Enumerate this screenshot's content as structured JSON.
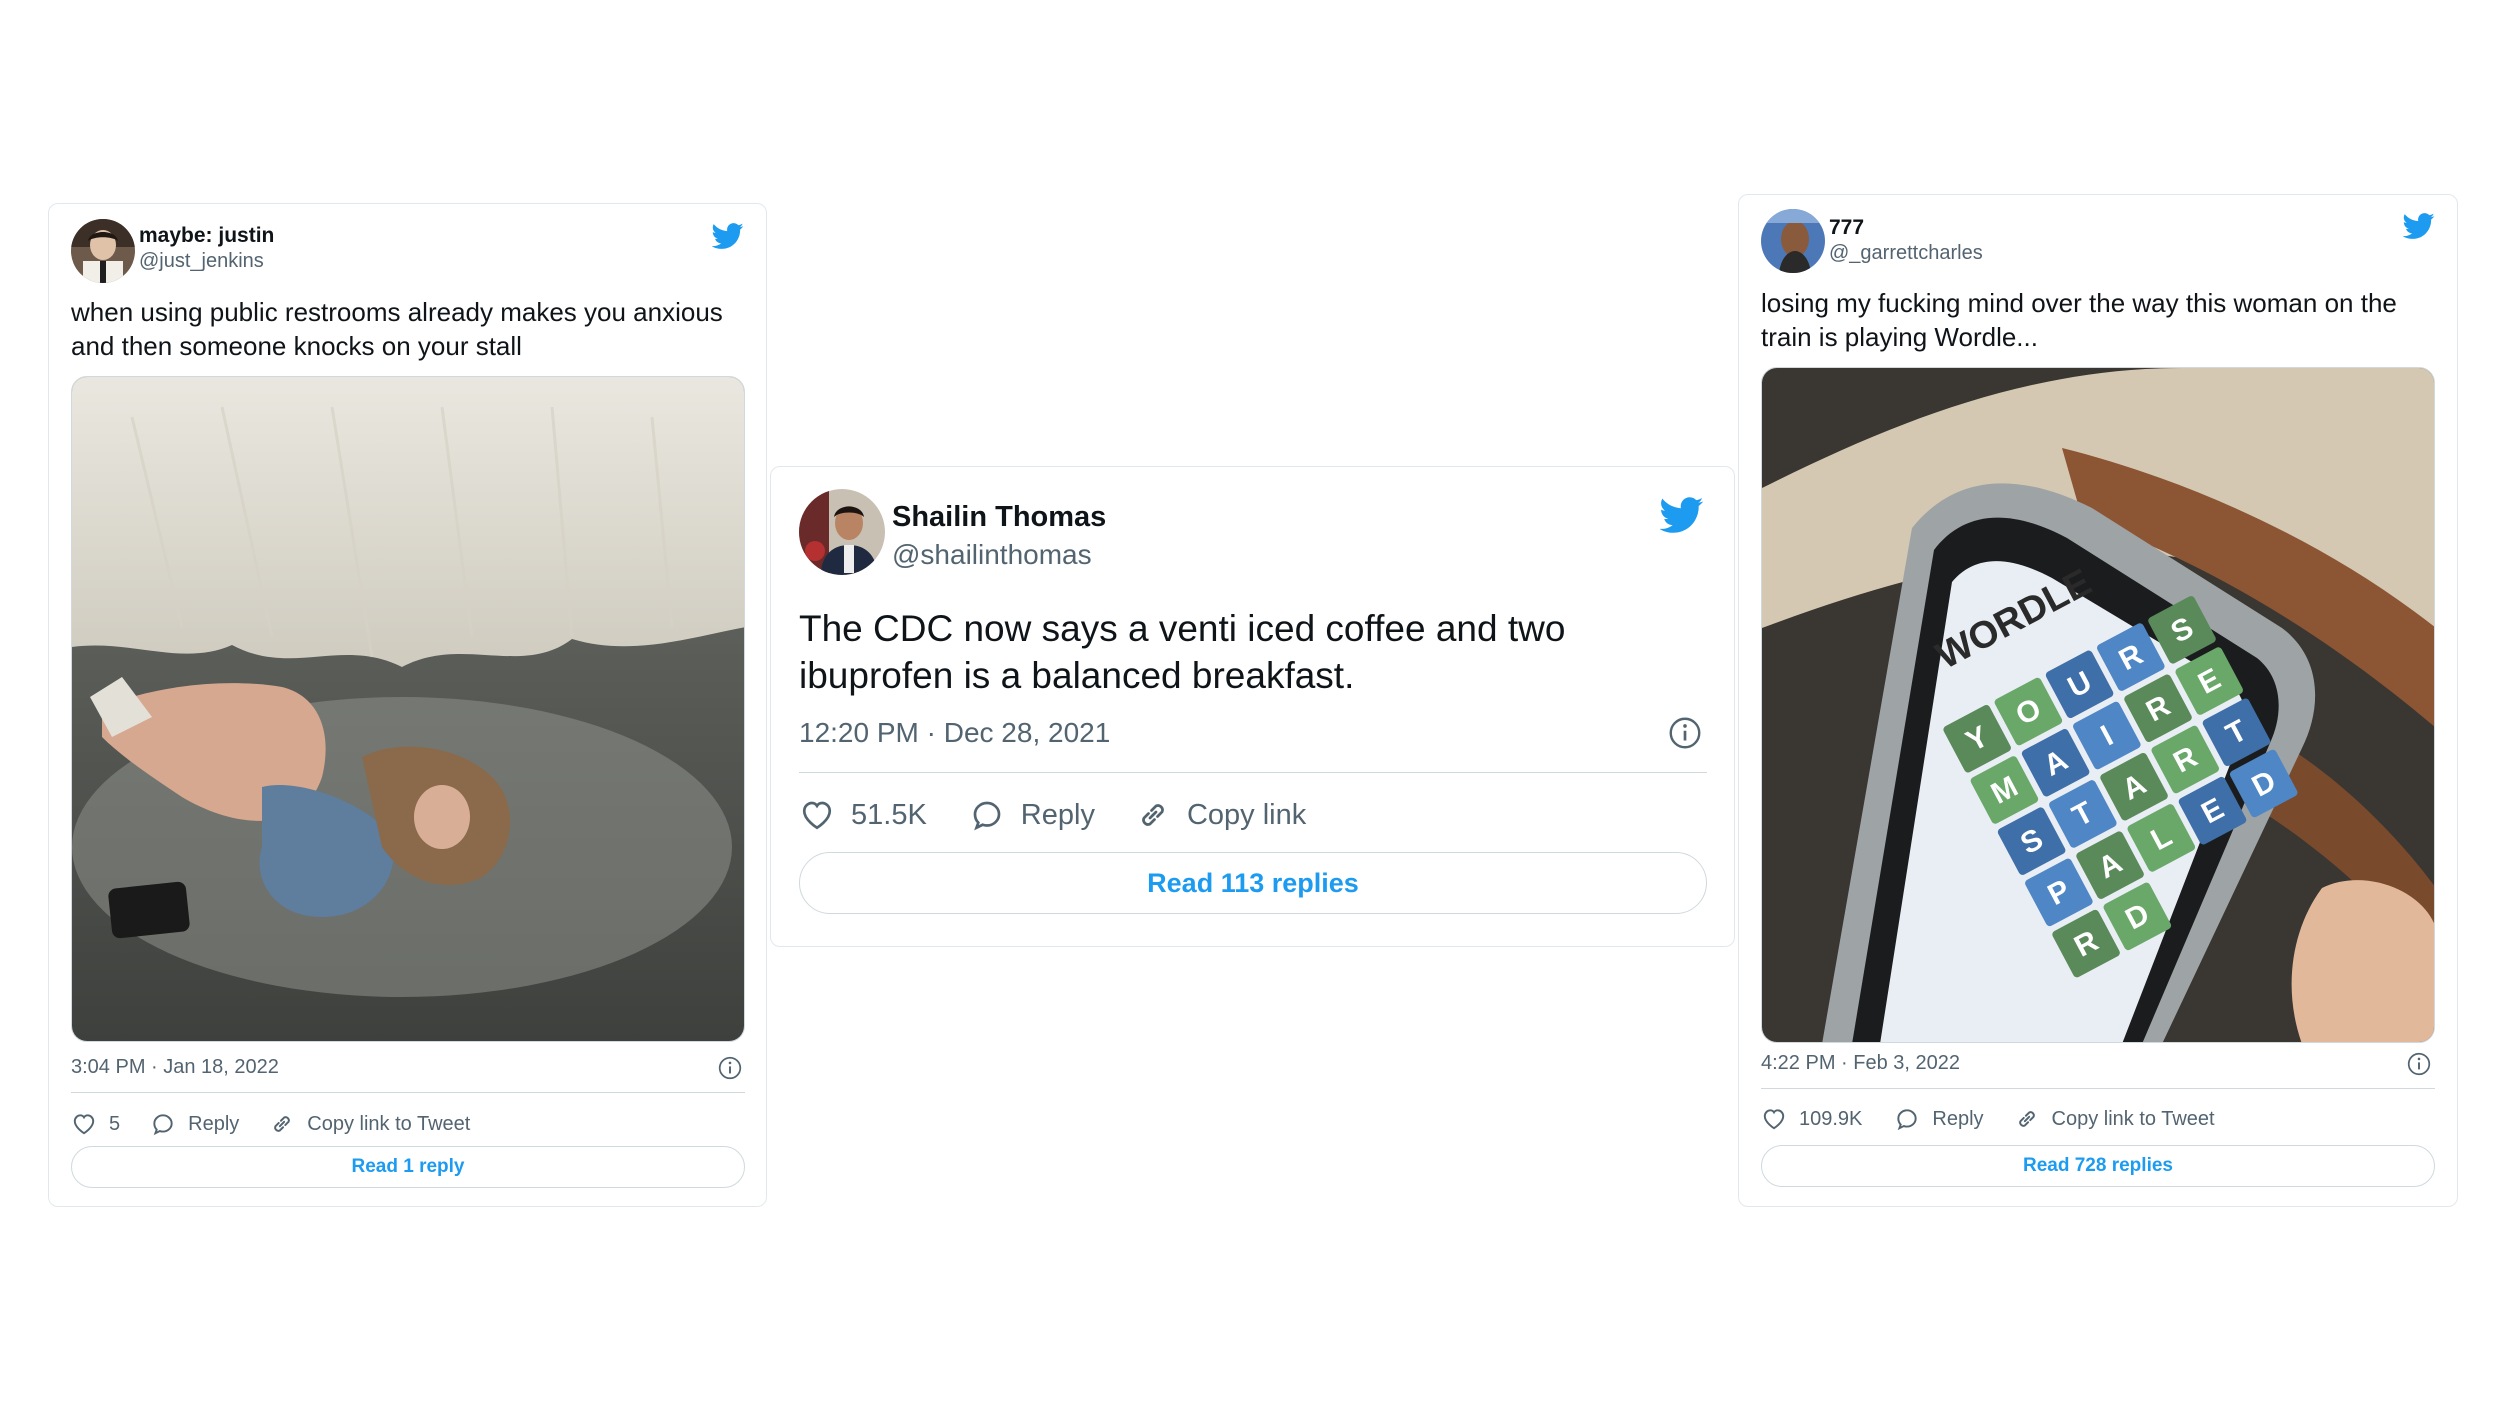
{
  "colors": {
    "twitter_blue": "#1d9bf0",
    "secondary_text": "#536471",
    "border": "#cfd9de"
  },
  "tweets": [
    {
      "name": "maybe: justin",
      "handle": "@just_jenkins",
      "text": "when using public restrooms already makes you anxious and then someone knocks on your stall",
      "timestamp": "3:04 PM · Jan 18, 2022",
      "likes": "5",
      "reply_label": "Reply",
      "copy_label": "Copy link to Tweet",
      "read_replies": "Read 1 reply",
      "icons": [
        "twitter-bird-icon",
        "info-icon",
        "heart-icon",
        "reply-bubble-icon",
        "link-icon"
      ]
    },
    {
      "name": "Shailin Thomas",
      "handle": "@shailinthomas",
      "text": "The CDC now says a venti iced coffee and two ibuprofen is a balanced breakfast.",
      "timestamp": "12:20 PM · Dec 28, 2021",
      "likes": "51.5K",
      "reply_label": "Reply",
      "copy_label": "Copy link",
      "read_replies": "Read 113 replies",
      "icons": [
        "twitter-bird-icon",
        "info-icon",
        "heart-icon",
        "reply-bubble-icon",
        "link-icon"
      ]
    },
    {
      "name": "777",
      "handle": "@_garrettcharles",
      "text": "losing my fucking mind over the way this woman on the train is playing Wordle...",
      "timestamp": "4:22 PM · Feb 3, 2022",
      "likes": "109.9K",
      "reply_label": "Reply",
      "copy_label": "Copy link to Tweet",
      "read_replies": "Read 728 replies",
      "media_text": {
        "app_title": "WORDLE",
        "letters": [
          "Y",
          "O",
          "U",
          "R",
          "S",
          "M",
          "A",
          "I",
          "R",
          "E",
          "S",
          "T",
          "A",
          "R",
          "T",
          "P",
          "A",
          "L",
          "E",
          "D",
          "R",
          "D"
        ]
      },
      "icons": [
        "twitter-bird-icon",
        "info-icon",
        "heart-icon",
        "reply-bubble-icon",
        "link-icon"
      ]
    }
  ]
}
